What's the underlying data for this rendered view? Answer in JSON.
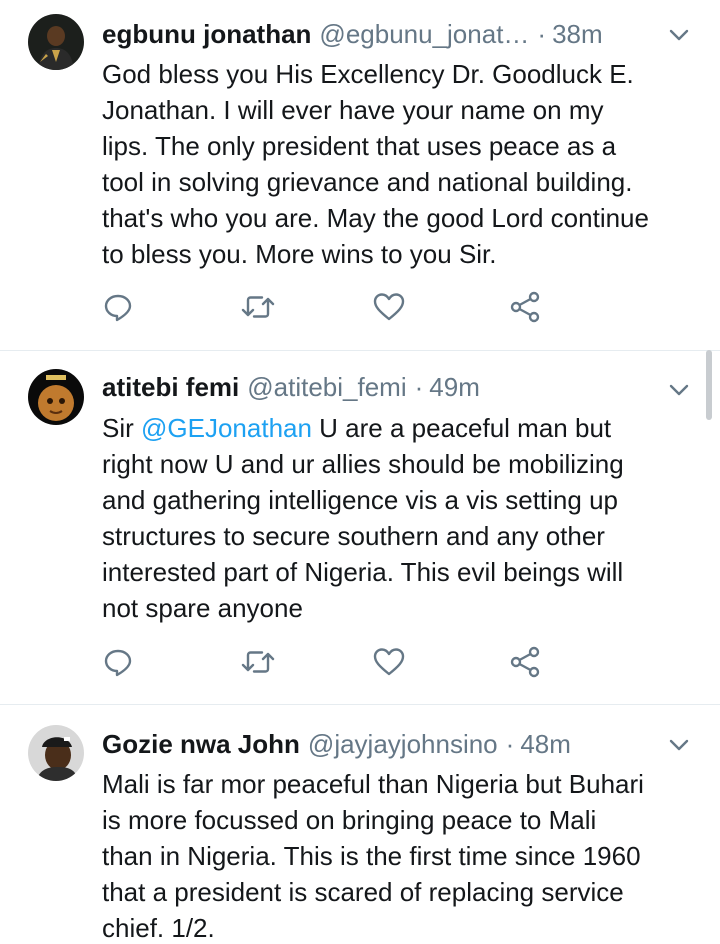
{
  "tweets": [
    {
      "name": "egbunu jonathan",
      "handle": "@egbunu_jonat…",
      "time": "38m",
      "lines": [
        "God bless you His Excellency Dr. Goodluck E.",
        "Jonathan. I will ever have your name on my",
        "lips. The only president that uses peace as a",
        "tool in solving grievance and national building.",
        "that's who you are. May the good Lord continue",
        "to bless you. More wins to you Sir."
      ]
    },
    {
      "name": "atitebi femi",
      "handle": "@atitebi_femi",
      "time": "49m",
      "first_line_prefix": "Sir ",
      "mention": "@GEJonathan",
      "first_line_rest": " U are a peaceful man but",
      "lines": [
        "right now U and ur allies should be mobilizing",
        "and gathering intelligence vis a vis setting up",
        "structures to secure southern and any other",
        "interested part of Nigeria. This evil beings will",
        "not spare anyone"
      ]
    },
    {
      "name": "Gozie nwa John",
      "handle": "@jayjayjohnsino",
      "time": "48m",
      "lines": [
        "Mali is far mor peaceful than Nigeria but Buhari",
        "is more focussed on bringing peace to Mali",
        "than in Nigeria. This is the first time since 1960",
        "that a president is scared of replacing service",
        "chief. 1/2."
      ]
    }
  ],
  "separator": "·",
  "icons": {
    "reply": "reply-icon",
    "retweet": "retweet-icon",
    "like": "heart-icon",
    "share": "share-icon",
    "menu": "chevron-down-icon"
  },
  "colors": {
    "text": "#14171a",
    "secondary": "#657786",
    "link": "#1da1f2",
    "icon": "#657786"
  }
}
